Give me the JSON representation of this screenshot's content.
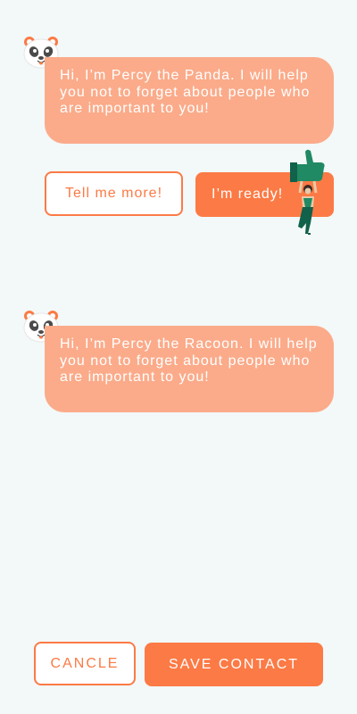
{
  "chat": {
    "message_1": "Hi, I’m Percy the Panda. I will help you not to forget about people who are important to you!",
    "message_2": "Hi, I’m Percy the Racoon. I will help you not to forget about people who are important to you!"
  },
  "actions": {
    "tell_more_label": "Tell me more!",
    "ready_label": "I’m ready!"
  },
  "footer": {
    "cancel_label": "CANCLE",
    "save_label": "SAVE CONTACT"
  },
  "colors": {
    "accent": "#fc7a45",
    "bubble": "#fbab8a",
    "background": "#f3f8f8",
    "illustration_green": "#1f8a63"
  },
  "icons": {
    "avatar": "panda-icon",
    "illustration": "thumbs-up-person-illustration"
  }
}
